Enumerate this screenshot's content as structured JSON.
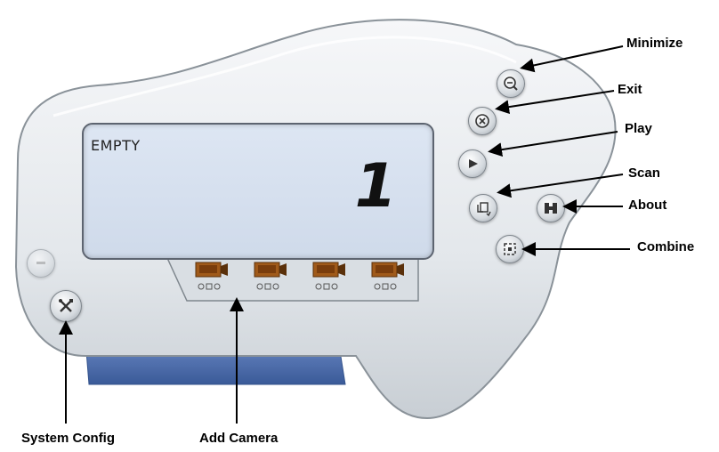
{
  "display": {
    "status_text": "EMPTY",
    "channel_number": "1"
  },
  "cameras": [
    {
      "icon": "camera-icon"
    },
    {
      "icon": "camera-icon"
    },
    {
      "icon": "camera-icon"
    },
    {
      "icon": "camera-icon"
    }
  ],
  "buttons": {
    "minimize": {
      "icon": "zoom-out-icon"
    },
    "exit": {
      "icon": "close-circle-icon"
    },
    "play": {
      "icon": "play-icon"
    },
    "scan": {
      "icon": "scan-icon"
    },
    "about": {
      "icon": "about-icon"
    },
    "combine": {
      "icon": "combine-icon"
    },
    "system_config": {
      "icon": "tools-icon"
    },
    "side_blank": {
      "icon": "blank-button-icon"
    }
  },
  "labels": {
    "minimize": "Minimize",
    "exit": "Exit",
    "play": "Play",
    "scan": "Scan",
    "about": "About",
    "combine": "Combine",
    "system_config": "System Config",
    "add_camera": "Add Camera"
  },
  "colors": {
    "body": "#e4e8ec",
    "lcd": "#d6e0ee",
    "base": "#4a6aa8",
    "camera": "#a05a1a"
  }
}
